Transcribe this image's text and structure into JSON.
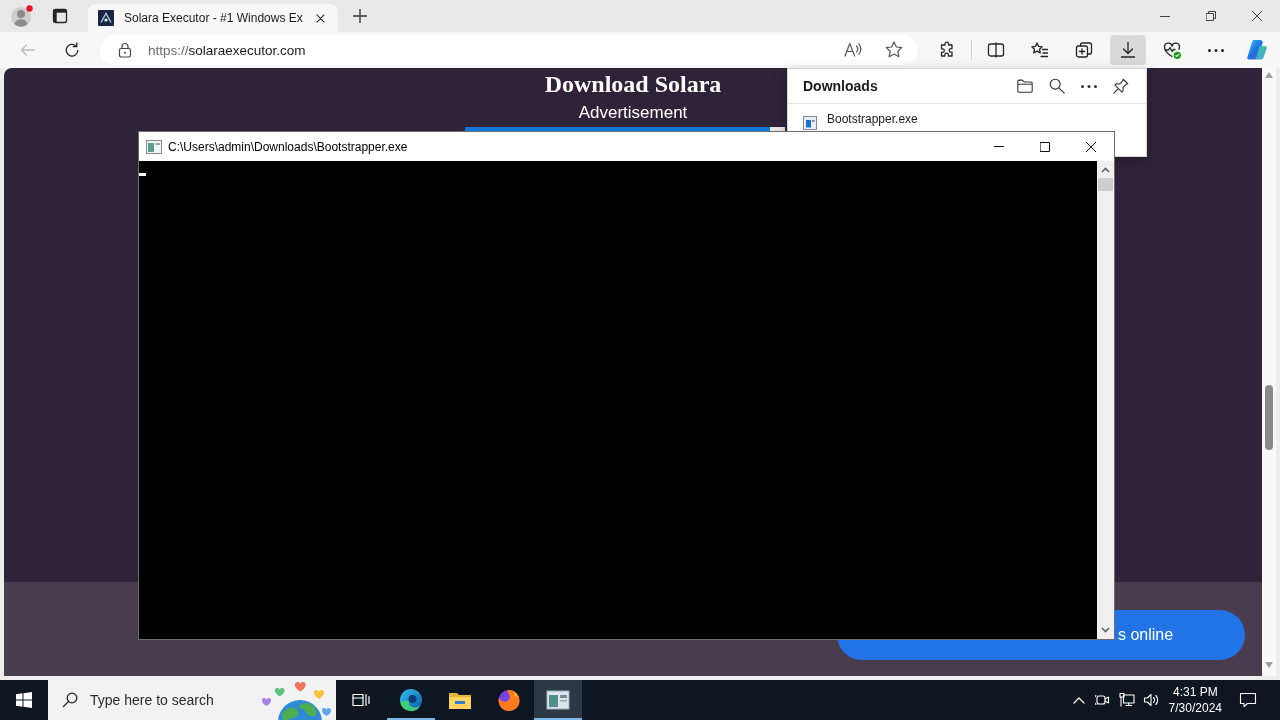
{
  "browser": {
    "tabs": [
      {
        "title": "Solara Executor - #1 Windows Ex",
        "selected": true
      }
    ],
    "back": {
      "disabled": true
    },
    "address": {
      "scheme": "https://",
      "host": "solaraexecutor.com"
    },
    "toolbar": [
      {
        "kind": "extensions",
        "selected": false
      },
      {
        "kind": "split-screen",
        "selected": false
      },
      {
        "kind": "favorites",
        "selected": false
      },
      {
        "kind": "collections",
        "selected": false
      },
      {
        "kind": "downloads",
        "selected": true
      },
      {
        "kind": "essentials",
        "selected": false
      },
      {
        "kind": "more",
        "selected": false
      },
      {
        "kind": "copilot",
        "selected": false
      }
    ]
  },
  "page": {
    "heading": "Download Solara",
    "ad_label": "Advertisement",
    "button_text": "s online"
  },
  "downloads_panel": {
    "title": "Downloads",
    "items": [
      {
        "name": "Bootstrapper.exe"
      }
    ]
  },
  "console": {
    "title": "C:\\Users\\admin\\Downloads\\Bootstrapper.exe"
  },
  "taskbar": {
    "search": {
      "placeholder": "Type here to search"
    },
    "apps": [
      {
        "kind": "edge",
        "running": true,
        "selected": false
      },
      {
        "kind": "explorer",
        "running": false,
        "selected": false
      },
      {
        "kind": "firefox",
        "running": false,
        "selected": false
      },
      {
        "kind": "console",
        "running": true,
        "selected": true
      }
    ],
    "clock": {
      "time": "4:31 PM",
      "date": "7/30/2024"
    }
  }
}
